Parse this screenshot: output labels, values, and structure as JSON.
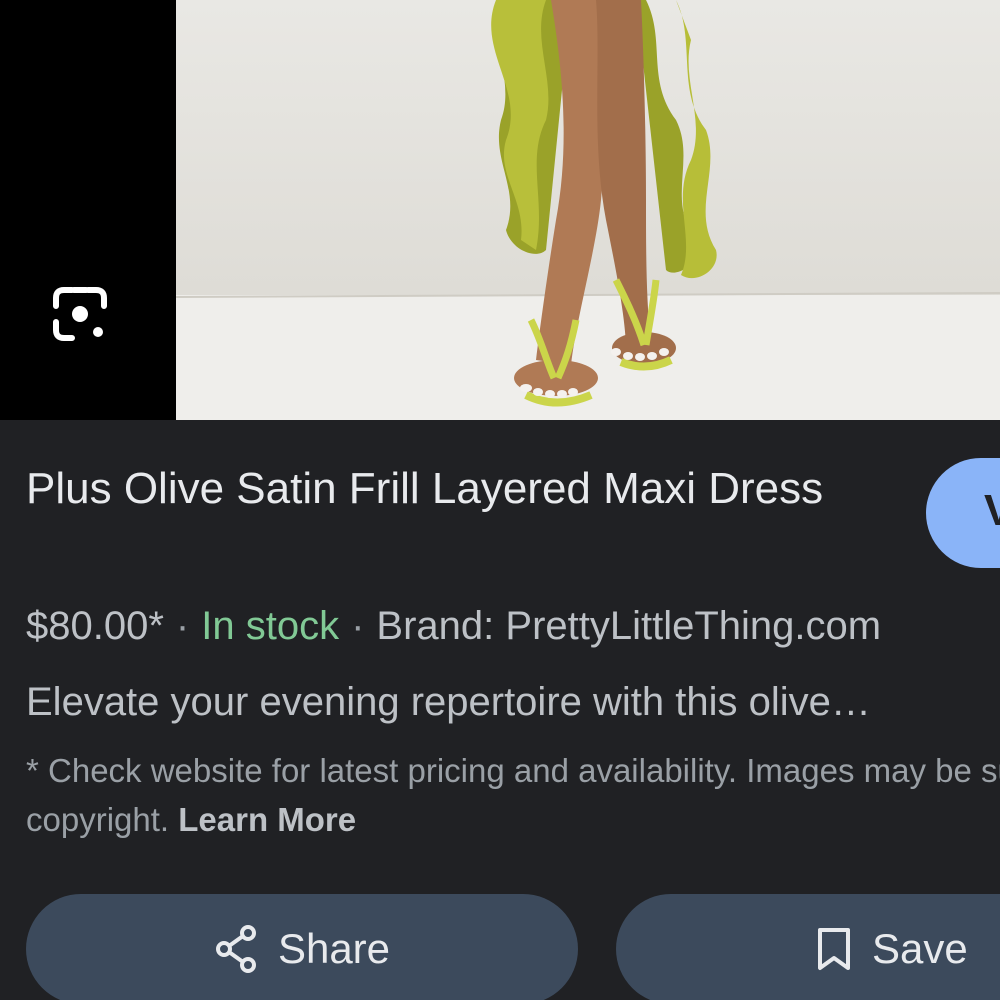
{
  "image_viewer": {
    "lens_icon": "google-lens-icon",
    "photo_description_icon": "product-photo"
  },
  "product": {
    "title": "Plus Olive Satin Frill Layered Maxi Dress",
    "price": "$80.00*",
    "separator": "·",
    "stock": "In stock",
    "brand": "Brand: PrettyLittleThing.com",
    "description": "Elevate your evening repertoire with this olive…",
    "disclaimer": "* Check website for latest pricing and availability. Images may be subject to copyright.",
    "learn_more": "Learn More"
  },
  "visit_button": {
    "label": "V"
  },
  "actions": {
    "share_label": "Share",
    "share_icon": "share-icon",
    "save_label": "Save",
    "save_icon": "bookmark-icon"
  },
  "colors": {
    "background": "#202124",
    "text_primary": "#e8eaed",
    "text_secondary": "#bdc1c6",
    "in_stock": "#81c995",
    "visit_button": "#8ab4f8",
    "action_button": "#3c4a5c"
  }
}
